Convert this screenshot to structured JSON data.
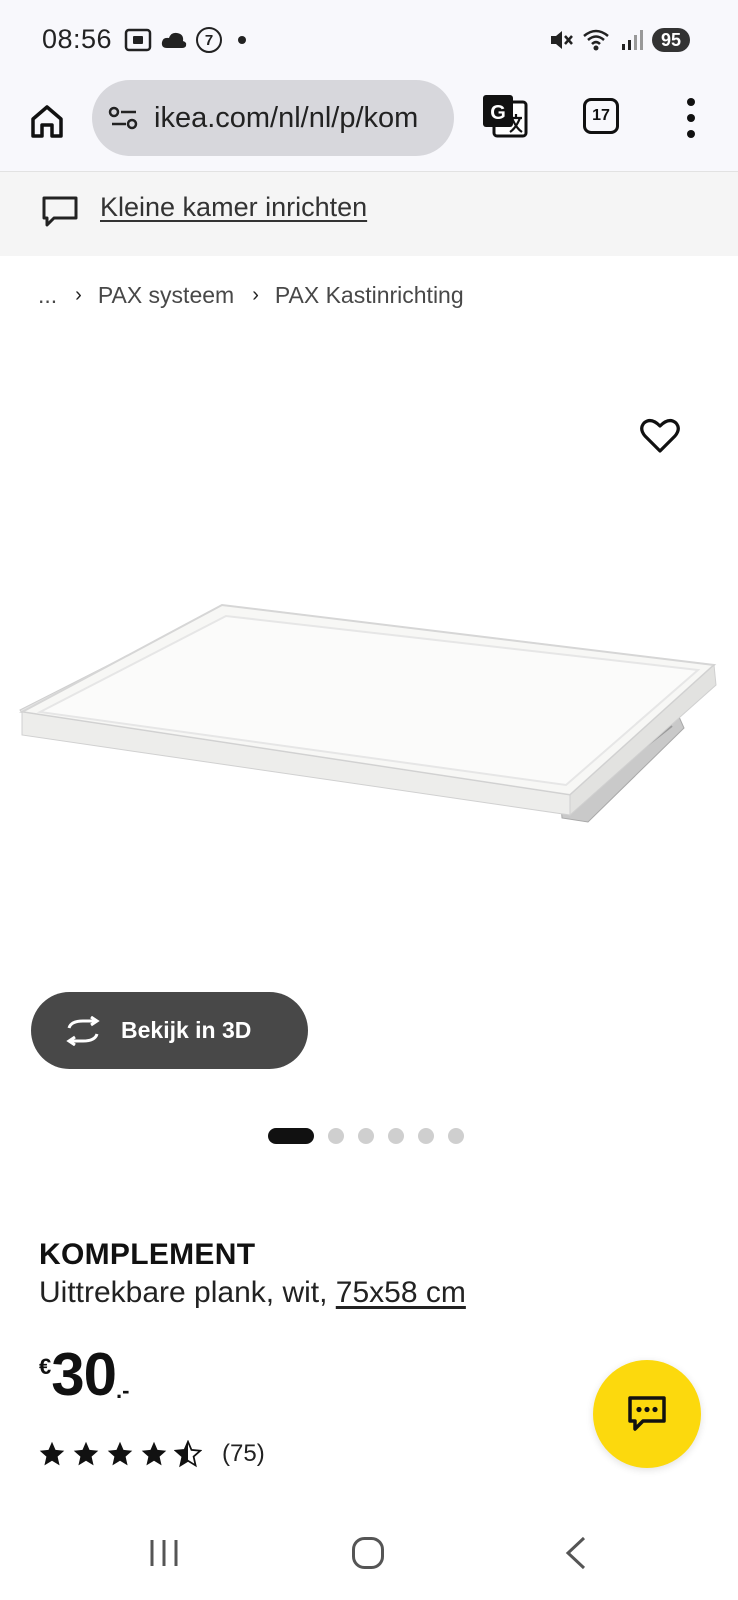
{
  "status_bar": {
    "time": "08:56",
    "notification_badge": "7",
    "battery": "95"
  },
  "browser": {
    "url": "ikea.com/nl/nl/p/kom",
    "tab_count": "17"
  },
  "banner": {
    "link_text": "Kleine kamer inrichten"
  },
  "breadcrumb": {
    "ellipsis": "...",
    "items": [
      "PAX systeem",
      "PAX Kastinrichting"
    ]
  },
  "gallery": {
    "view_3d_label": "Bekijk in 3D",
    "image_count": 6,
    "active_index": 0
  },
  "product": {
    "name": "KOMPLEMENT",
    "description": "Uittrekbare plank, wit, ",
    "size": "75x58 cm",
    "price_currency": "€",
    "price_integer": "30",
    "price_decimal": ".-",
    "rating_value": 4.5,
    "rating_max": 5,
    "review_count": "(75)"
  },
  "colors": {
    "accent_yellow": "#fcd90d",
    "button_dark": "#484848"
  }
}
